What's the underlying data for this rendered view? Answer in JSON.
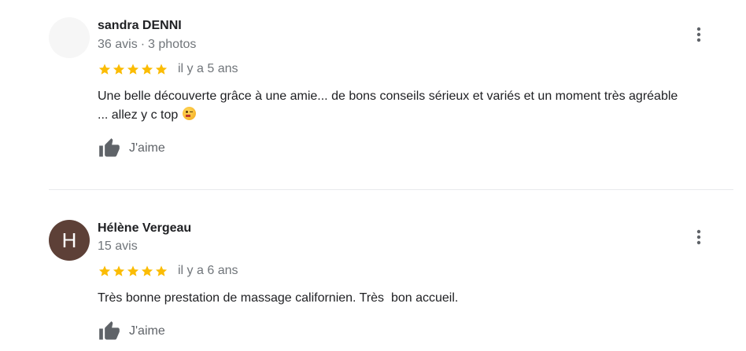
{
  "reviews": [
    {
      "name": "sandra DENNI",
      "count": "36 avis",
      "separator": "·",
      "photos": "3 photos",
      "rating": 5,
      "time": "il y a 5 ans",
      "text_line1": "Une belle découverte grâce à une amie... de bons conseils sérieux et variés et un moment très agréable",
      "text_line2": "... allez y c top",
      "emoji": "winking-face",
      "like_label": "J'aime"
    },
    {
      "name": "Hélène Vergeau",
      "avatar_letter": "H",
      "avatar_color": "#5d4037",
      "count": "15 avis",
      "rating": 5,
      "time": "il y a 6 ans",
      "text": "Très bonne prestation de massage californien. Très  bon accueil.",
      "like_label": "J'aime"
    }
  ],
  "colors": {
    "star": "#fbbc04",
    "secondary_text": "#70757a",
    "icon": "#5f6368"
  }
}
